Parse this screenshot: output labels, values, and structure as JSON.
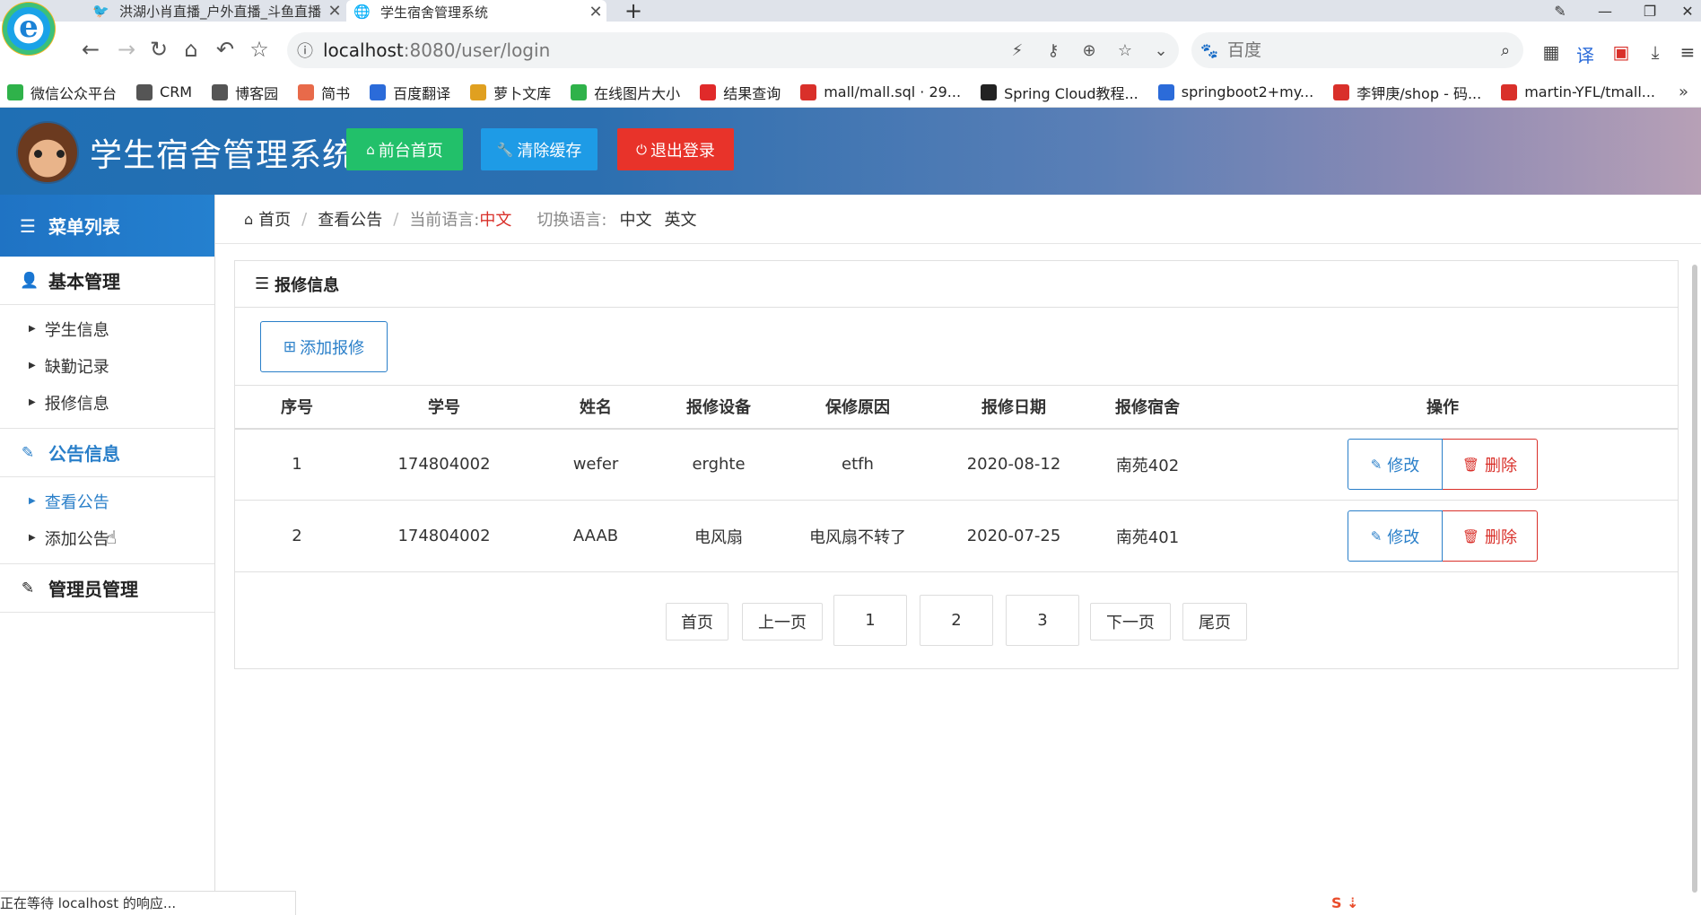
{
  "browser": {
    "tabs": [
      {
        "title": "洪湖小肖直播_户外直播_斗鱼直播",
        "favicon": "bird-icon"
      },
      {
        "title": "学生宿舍管理系统",
        "favicon": "globe-icon"
      }
    ],
    "address": {
      "host": "localhost",
      "rest": ":8080/user/login"
    },
    "search_placeholder": "百度",
    "bookmarks": [
      {
        "label": "微信公众平台",
        "color": "#2fb24a"
      },
      {
        "label": "CRM",
        "color": "#555555"
      },
      {
        "label": "博客园",
        "color": "#555555"
      },
      {
        "label": "简书",
        "color": "#e86a4a"
      },
      {
        "label": "百度翻译",
        "color": "#2b6bd9"
      },
      {
        "label": "萝卜文库",
        "color": "#e0a020"
      },
      {
        "label": "在线图片大小",
        "color": "#2fb24a"
      },
      {
        "label": "结果查询",
        "color": "#e02a2a"
      },
      {
        "label": "mall/mall.sql · 29...",
        "color": "#d9302a"
      },
      {
        "label": "Spring Cloud教程...",
        "color": "#222222"
      },
      {
        "label": "springboot2+my...",
        "color": "#2b6bd9"
      },
      {
        "label": "李钾庚/shop - 码...",
        "color": "#d9302a"
      },
      {
        "label": "martin-YFL/tmall...",
        "color": "#d9302a"
      }
    ],
    "status_text": "正在等待 localhost 的响应..."
  },
  "header": {
    "title": "学生宿舍管理系统",
    "buttons": {
      "home": "前台首页",
      "clear_cache": "清除缓存",
      "logout": "退出登录"
    },
    "colors": {
      "home": "#22c06a",
      "clear_cache": "#1e9be6",
      "logout": "#e8332a"
    }
  },
  "sidebar": {
    "title": "菜单列表",
    "groups": [
      {
        "label": "基本管理",
        "items": [
          "学生信息",
          "缺勤记录",
          "报修信息"
        ]
      },
      {
        "label": "公告信息",
        "items": [
          "查看公告",
          "添加公告"
        ]
      },
      {
        "label": "管理员管理",
        "items": []
      }
    ]
  },
  "breadcrumb": {
    "home": "首页",
    "current": "查看公告",
    "current_lang_label": "当前语言:",
    "current_lang_value": "中文",
    "switch_label": "切换语言:",
    "lang_zh": "中文",
    "lang_en": "英文"
  },
  "panel": {
    "title": "报修信息",
    "add_button": "添加报修",
    "columns": [
      "序号",
      "学号",
      "姓名",
      "报修设备",
      "保修原因",
      "报修日期",
      "报修宿舍",
      "操作"
    ],
    "rows": [
      [
        "1",
        "174804002",
        "wefer",
        "erghte",
        "etfh",
        "2020-08-12",
        "南苑402"
      ],
      [
        "2",
        "174804002",
        "AAAB",
        "电风扇",
        "电风扇不转了",
        "2020-07-25",
        "南苑401"
      ]
    ],
    "row_actions": {
      "edit": "修改",
      "delete": "删除"
    }
  },
  "pager": {
    "first": "首页",
    "prev": "上一页",
    "pages": [
      "1",
      "2",
      "3"
    ],
    "next": "下一页",
    "last": "尾页"
  }
}
